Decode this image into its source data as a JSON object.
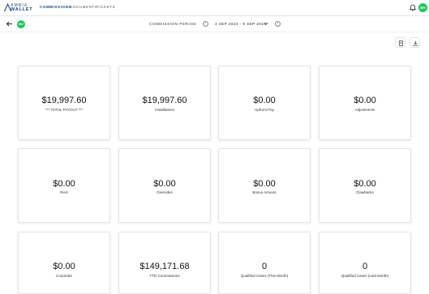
{
  "app": {
    "logo_top": "AMBIA",
    "logo_bottom": "WALLET",
    "nav": [
      "COMMISSIONS",
      "DOCUMENTS",
      "TICKETS"
    ],
    "user_initials": "BV",
    "accent_color": "#22c55e",
    "brand_color": "#1f3a75"
  },
  "subbar": {
    "rep_initials": "BV",
    "period_label": "COMMISSION PERIOD",
    "period_value": "3 SEP 2023 - 9 SEP 2023"
  },
  "cards": [
    {
      "value": "$19,997.60",
      "label": "*** TOTAL PAYOUT ***"
    },
    {
      "value": "$19,997.60",
      "label": "Installations"
    },
    {
      "value": "$0.00",
      "label": "Upfront Pay"
    },
    {
      "value": "$0.00",
      "label": "Adjustments"
    },
    {
      "value": "$0.00",
      "label": "Rent"
    },
    {
      "value": "$0.00",
      "label": "Overrides"
    },
    {
      "value": "$0.00",
      "label": "Bonus Amount"
    },
    {
      "value": "$0.00",
      "label": "Clawbacks"
    },
    {
      "value": "$0.00",
      "label": "Corporate"
    },
    {
      "value": "$149,171.68",
      "label": "YTD Commissions"
    },
    {
      "value": "0",
      "label": "Qualified Cases (This Month)"
    },
    {
      "value": "0",
      "label": "Qualified Cases (Last Month)"
    }
  ]
}
